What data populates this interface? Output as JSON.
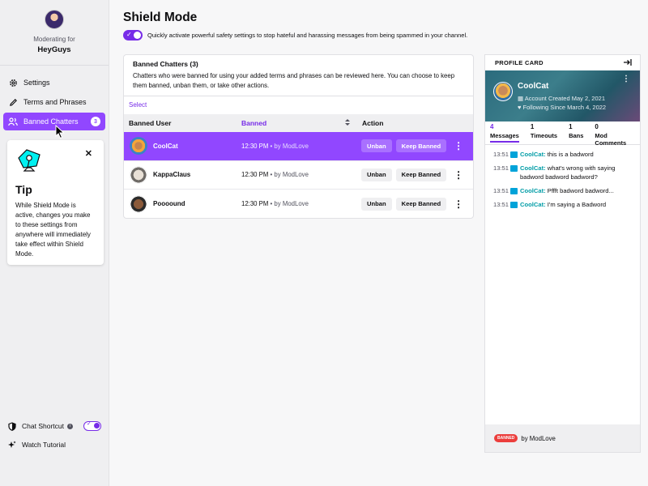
{
  "sidebar": {
    "moderating_label": "Moderating for",
    "channel_name": "HeyGuys",
    "items": [
      {
        "label": "Settings",
        "icon": "gear-icon"
      },
      {
        "label": "Terms and Phrases",
        "icon": "pencil-icon"
      },
      {
        "label": "Banned Chatters",
        "icon": "users-icon",
        "badge": "3",
        "active": true
      }
    ],
    "tip": {
      "title": "Tip",
      "text": "While Shield Mode is active, changes you make to these settings from anywhere will immediately take effect within Shield Mode."
    },
    "chat_shortcut_label": "Chat Shortcut",
    "chat_shortcut_on": true,
    "watch_tutorial_label": "Watch Tutorial"
  },
  "main": {
    "title": "Shield Mode",
    "subtitle": "Quickly activate powerful safety settings to stop hateful and harassing messages from being spammed in your channel.",
    "shield_on": true,
    "panel": {
      "title": "Banned Chatters (3)",
      "description": "Chatters who were banned for using your added terms and phrases can be reviewed here. You can choose to keep them banned, unban them, or take other actions.",
      "select_label": "Select",
      "columns": {
        "user": "Banned User",
        "banned": "Banned",
        "action": "Action"
      },
      "unban_label": "Unban",
      "keep_label": "Keep Banned",
      "rows": [
        {
          "user": "CoolCat",
          "time": "12:30 PM",
          "by": " • by ModLove",
          "selected": true
        },
        {
          "user": "KappaClaus",
          "time": "12:30 PM",
          "by": " • by ModLove",
          "selected": false
        },
        {
          "user": "Poooound",
          "time": "12:30 PM",
          "by": " • by ModLove",
          "selected": false
        }
      ]
    }
  },
  "profile_card": {
    "header": "PROFILE CARD",
    "name": "CoolCat",
    "account_created": "Account Created May 2, 2021",
    "following_since": "Following Since March 4, 2022",
    "stats": [
      {
        "num": "4",
        "label": "Messages"
      },
      {
        "num": "1",
        "label": "Timeouts"
      },
      {
        "num": "1",
        "label": "Bans"
      },
      {
        "num": "0",
        "label": "Mod Comments"
      }
    ],
    "messages": [
      {
        "time": "13:51",
        "user": "CoolCat",
        "text": "this is a badword"
      },
      {
        "time": "13:51",
        "user": "CoolCat",
        "text": "what's wrong with saying badword badword badword?"
      },
      {
        "time": "13:51",
        "user": "CoolCat",
        "text": "Pffft badword badword..."
      },
      {
        "time": "13:51",
        "user": "CoolCat",
        "text": "I'm saying a Badword"
      }
    ],
    "footer_badge": "BANNED",
    "footer_text": "by ModLove"
  },
  "colors": {
    "accent": "#9147ff",
    "accent_dark": "#772ce8",
    "username": "#009ca6"
  }
}
